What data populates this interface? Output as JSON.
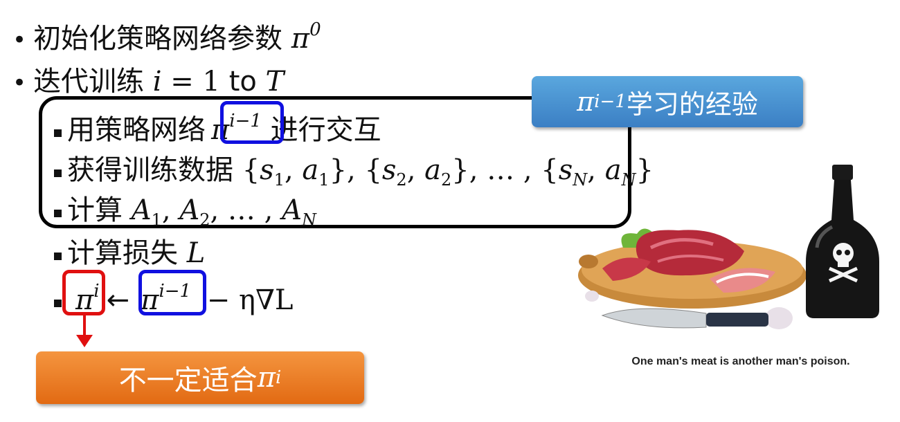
{
  "bullets": [
    {
      "text": "初始化策略网络参数 ",
      "math": "π",
      "sup": "0"
    },
    {
      "text": "迭代训练 ",
      "math_pre": "i",
      "eq": " = 1 ",
      "to": "to",
      "math_post": " T"
    }
  ],
  "sub_items": {
    "interact_pre": "用策略网络",
    "interact_post": " 进行交互",
    "data_label": "获得训练数据 ",
    "compute_a_label": "计算 ",
    "loss_label": "计算损失 ",
    "loss_var": "L",
    "update_rest": " − η∇L"
  },
  "policy_prev_sup": "i−1",
  "policy_cur_sup": "i",
  "experience_box": {
    "text": "学习的经验",
    "sup": "i−1"
  },
  "warning_box": {
    "text": "不一定适合",
    "sup": "i"
  },
  "image": {
    "caption": "One man's meat is another man's poison.",
    "icons": [
      "meat-board-icon",
      "knife-icon",
      "poison-bottle-icon",
      "skull-icon",
      "garlic-icon"
    ]
  },
  "colors": {
    "blue": "#1010e0",
    "red": "#e01010",
    "orange": "#ef7d22",
    "steelblue": "#4a90d2"
  }
}
